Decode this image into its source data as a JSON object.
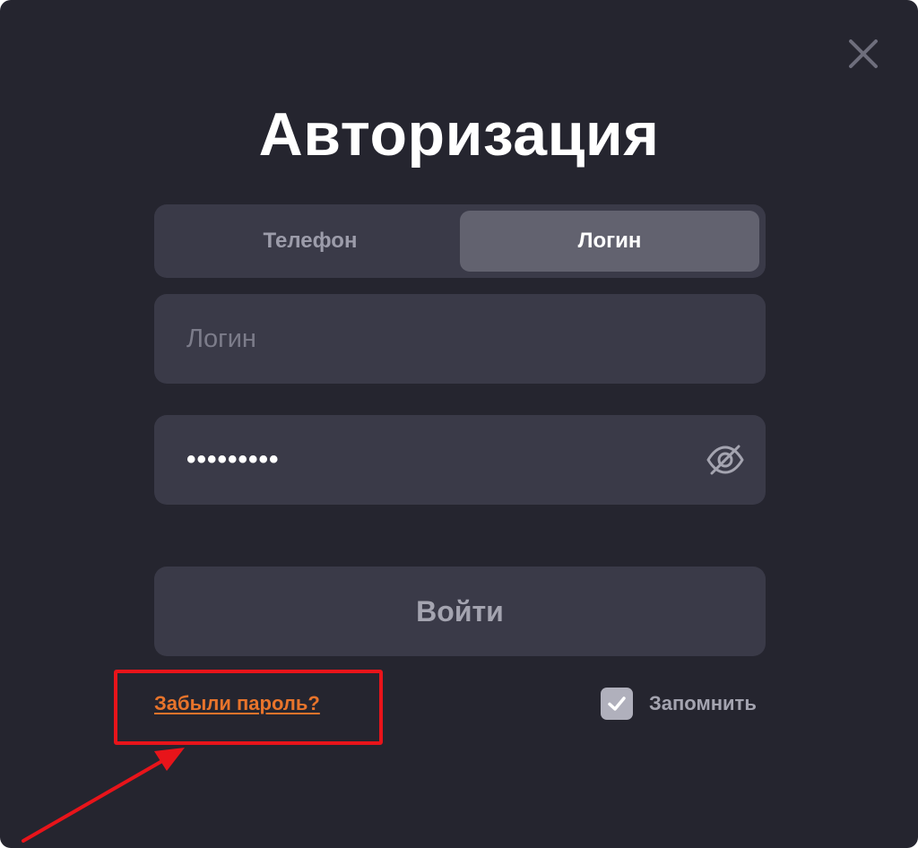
{
  "dialog": {
    "title": "Авторизация",
    "close_icon": "close-icon"
  },
  "tabs": [
    {
      "label": "Телефон",
      "active": false
    },
    {
      "label": "Логин",
      "active": true
    }
  ],
  "login_field": {
    "placeholder": "Логин",
    "value": ""
  },
  "password_field": {
    "value": "•••••••••",
    "toggle_icon": "eye-off-icon"
  },
  "submit": {
    "label": "Войти"
  },
  "forgot_password": {
    "label": "Забыли пароль?"
  },
  "remember": {
    "label": "Запомнить",
    "checked": true
  },
  "annotation": {
    "highlight_color": "#e8141a",
    "target": "forgot_password"
  },
  "colors": {
    "background": "#25252f",
    "field": "#3a3a48",
    "active_tab": "#62626f",
    "link": "#e8742b"
  }
}
